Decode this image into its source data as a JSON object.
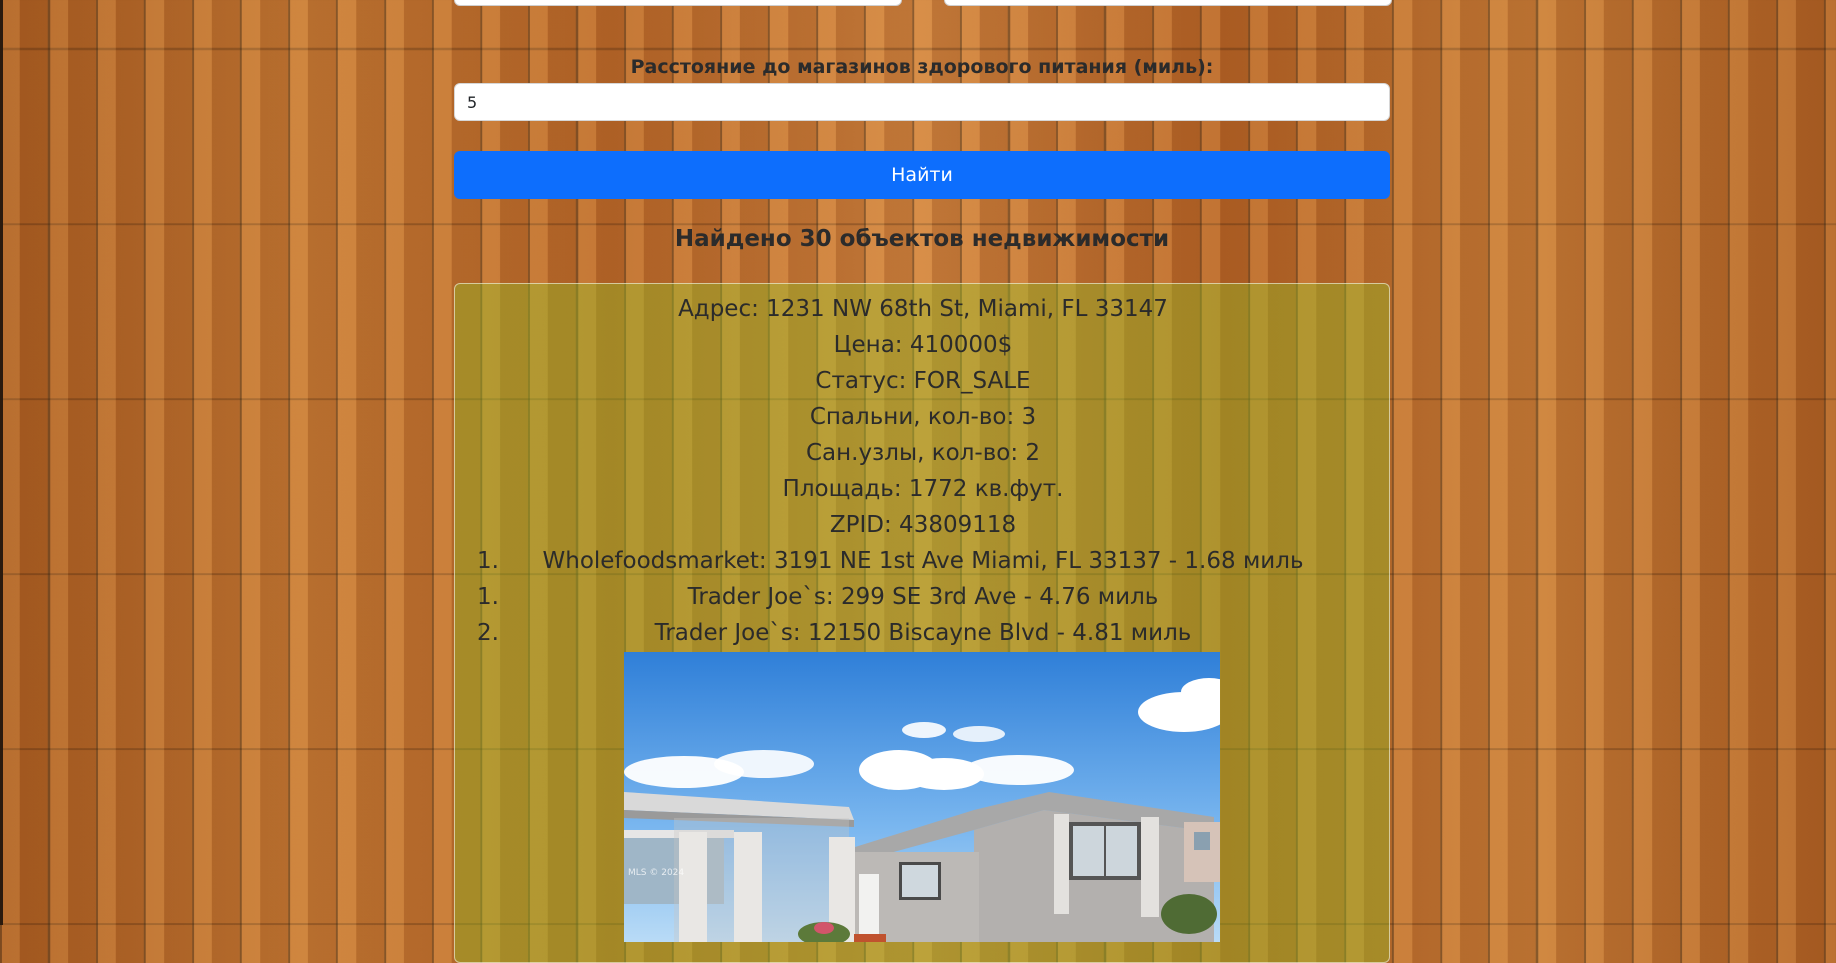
{
  "form": {
    "distance_label": "Расстояние до магазинов здорового питания (миль):",
    "distance_value": "5",
    "search_button": "Найти"
  },
  "results": {
    "heading": "Найдено 30 объектов недвижимости"
  },
  "listing": {
    "address": "Адрес: 1231 NW 68th St, Miami, FL 33147",
    "price": "Цена: 410000$",
    "status": "Статус: FOR_SALE",
    "bedrooms": "Спальни, кол-во: 3",
    "bathrooms": "Сан.узлы, кол-во: 2",
    "area": "Площадь: 1772 кв.фут.",
    "zpid": "ZPID: 43809118",
    "stores": [
      {
        "num": "1.",
        "text": "Wholefoodsmarket: 3191 NE 1st Ave Miami, FL 33137 - 1.68 миль"
      },
      {
        "num": "1.",
        "text": "Trader Joe`s: 299 SE 3rd Ave - 4.76 миль"
      },
      {
        "num": "2.",
        "text": "Trader Joe`s: 12150 Biscayne Blvd - 4.81 миль"
      }
    ],
    "photo_watermark": "MLS © 2024"
  }
}
